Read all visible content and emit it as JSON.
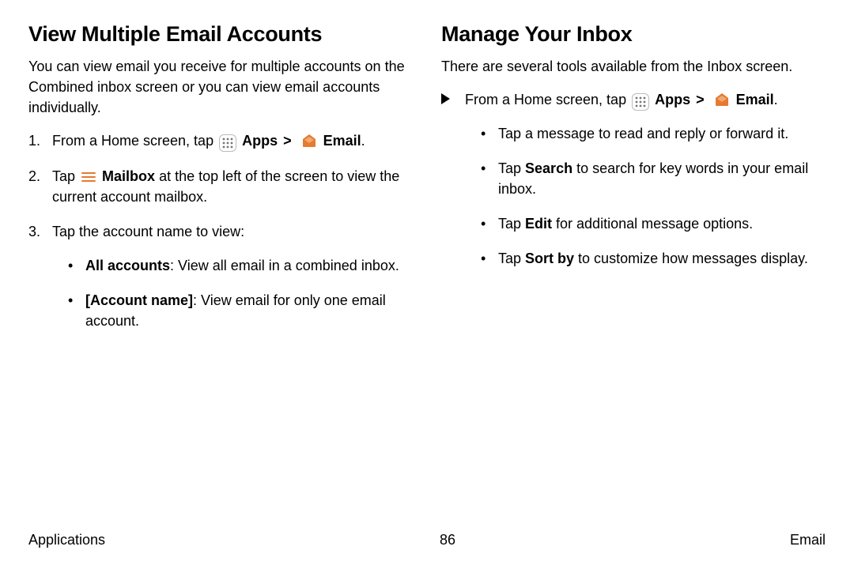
{
  "left": {
    "heading": "View Multiple Email Accounts",
    "intro": "You can view email you receive for multiple accounts on the Combined inbox screen or you can view email accounts individually.",
    "step1_pre": "From a Home screen, tap ",
    "step1_apps": "Apps",
    "step1_sep": " > ",
    "step1_email": "Email",
    "step1_post": ".",
    "step2_pre": "Tap ",
    "step2_mailbox": "Mailbox",
    "step2_post": " at the top left of the screen to view the current account mailbox.",
    "step3": "Tap the account name to view:",
    "sub1_b": "All accounts",
    "sub1_post": ": View all email in a combined inbox.",
    "sub2_b": "[Account name]",
    "sub2_post": ": View email for only one email account."
  },
  "right": {
    "heading": "Manage Your Inbox",
    "intro": "There are several tools available from the Inbox screen.",
    "lead_pre": "From a Home screen, tap ",
    "lead_apps": "Apps",
    "lead_sep": " > ",
    "lead_email": "Email",
    "lead_post": ".",
    "b1": "Tap a message to read and reply or forward it.",
    "b2_pre": "Tap ",
    "b2_b": "Search",
    "b2_post": " to search for key words in your email inbox.",
    "b3_pre": "Tap ",
    "b3_b": "Edit",
    "b3_post": " for additional message options.",
    "b4_pre": "Tap ",
    "b4_b": "Sort by",
    "b4_post": " to customize how messages display."
  },
  "footer": {
    "left": "Applications",
    "center": "86",
    "right": "Email"
  }
}
